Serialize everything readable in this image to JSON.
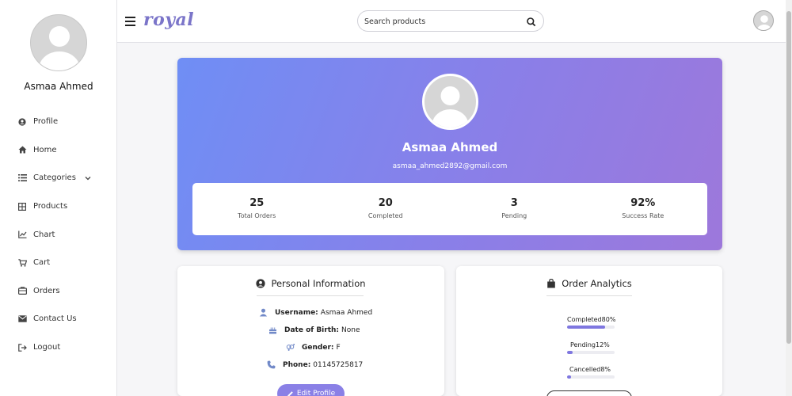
{
  "user": {
    "name": "Asmaa Ahmed",
    "email": "asmaa_ahmed2892@gmail.com"
  },
  "sidebar": {
    "items": [
      {
        "label": "Profile",
        "icon": "user-circle-icon"
      },
      {
        "label": "Home",
        "icon": "home-icon"
      },
      {
        "label": "Categories",
        "icon": "list-icon",
        "has_dropdown": true
      },
      {
        "label": "Products",
        "icon": "grid-icon"
      },
      {
        "label": "Chart",
        "icon": "line-chart-icon"
      },
      {
        "label": "Cart",
        "icon": "cart-icon"
      },
      {
        "label": "Orders",
        "icon": "orders-icon"
      },
      {
        "label": "Contact Us",
        "icon": "envelope-icon"
      },
      {
        "label": "Logout",
        "icon": "logout-icon"
      }
    ]
  },
  "topbar": {
    "logo": "royal",
    "search_placeholder": "Search products"
  },
  "stats": [
    {
      "value": "25",
      "label": "Total Orders"
    },
    {
      "value": "20",
      "label": "Completed"
    },
    {
      "value": "3",
      "label": "Pending"
    },
    {
      "value": "92%",
      "label": "Success Rate"
    }
  ],
  "personal_info": {
    "title": "Personal Information",
    "username_label": "Username:",
    "username_value": "Asmaa Ahmed",
    "dob_label": "Date of Birth:",
    "dob_value": "None",
    "gender_label": "Gender:",
    "gender_value": "F",
    "phone_label": "Phone:",
    "phone_value": "01145725817",
    "edit_button": "Edit Profile"
  },
  "order_analytics": {
    "title": "Order Analytics",
    "items": [
      {
        "label": "Completed80%",
        "percent": 80
      },
      {
        "label": "Pending12%",
        "percent": 12
      },
      {
        "label": "Cancelled8%",
        "percent": 8
      }
    ]
  },
  "colors": {
    "accent": "#8a80e6",
    "banner_start": "#6f8ef5",
    "banner_end": "#9d78db",
    "logo": "#7b75c9"
  }
}
